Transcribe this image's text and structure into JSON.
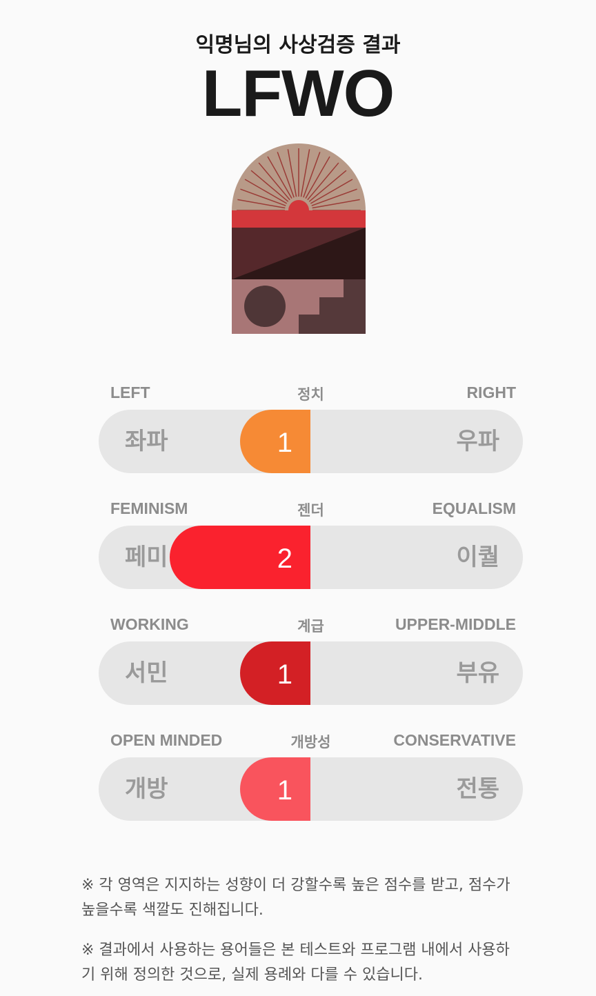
{
  "header": {
    "subtitle": "익명님의 사상검증 결과",
    "code": "LFWO"
  },
  "emblem": {
    "icon": "sunrise-arch-emblem-icon",
    "colors": {
      "arch": "#b89a88",
      "rays": "#9a3b36",
      "band": "#d3373b",
      "upper": "#55282b",
      "lower_dark": "#2d1717",
      "bottom": "#a87676",
      "circle": "#4f3637",
      "stairs": "#55393a"
    }
  },
  "axes": [
    {
      "left_en": "LEFT",
      "center": "정치",
      "right_en": "RIGHT",
      "left_ko": "좌파",
      "right_ko": "우파",
      "score": "1",
      "level": 1,
      "color": "#f68a35"
    },
    {
      "left_en": "FEMINISM",
      "center": "젠더",
      "right_en": "EQUALISM",
      "left_ko": "페미",
      "right_ko": "이퀄",
      "score": "2",
      "level": 2,
      "color": "#fa222e"
    },
    {
      "left_en": "WORKING",
      "center": "계급",
      "right_en": "UPPER-MIDDLE",
      "left_ko": "서민",
      "right_ko": "부유",
      "score": "1",
      "level": 1,
      "color": "#d32025"
    },
    {
      "left_en": "OPEN MINDED",
      "center": "개방성",
      "right_en": "CONSERVATIVE",
      "left_ko": "개방",
      "right_ko": "전통",
      "score": "1",
      "level": 1,
      "color": "#f9545d"
    }
  ],
  "notes": [
    "※ 각 영역은 지지하는 성향이 더 강할수록 높은 점수를 받고, 점수가 높을수록 색깔도 진해집니다.",
    "※ 결과에서 사용하는 용어들은 본 테스트와 프로그램 내에서 사용하기 위해 정의한 것으로, 실제 용례와 다를 수 있습니다."
  ]
}
